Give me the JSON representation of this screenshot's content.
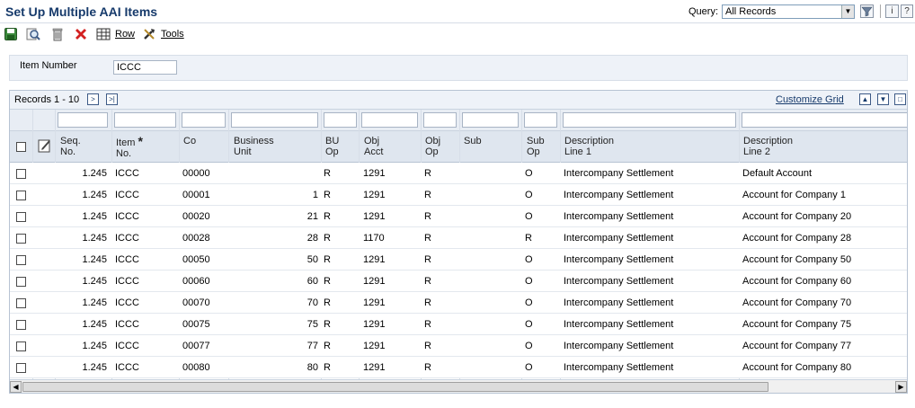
{
  "app": {
    "title": "Set Up Multiple AAI Items",
    "query_label": "Query:",
    "query_value": "All Records"
  },
  "toolbar": {
    "row_label": "Row",
    "tools_label": "Tools"
  },
  "header": {
    "item_number_label": "Item Number",
    "item_number_value": "ICCC"
  },
  "grid": {
    "records_label": "Records 1 - 10",
    "customize_label": "Customize Grid",
    "columns": [
      {
        "key": "seq",
        "line1": "Seq.",
        "line2": "No."
      },
      {
        "key": "item",
        "line1": "Item",
        "line2": "No."
      },
      {
        "key": "co",
        "line1": "",
        "line2": "Co"
      },
      {
        "key": "bu",
        "line1": "Business",
        "line2": "Unit"
      },
      {
        "key": "buop",
        "line1": "BU",
        "line2": "Op"
      },
      {
        "key": "obj",
        "line1": "Obj",
        "line2": "Acct"
      },
      {
        "key": "objop",
        "line1": "Obj",
        "line2": "Op"
      },
      {
        "key": "sub",
        "line1": "",
        "line2": "Sub"
      },
      {
        "key": "subop",
        "line1": "Sub",
        "line2": "Op"
      },
      {
        "key": "desc1",
        "line1": "Description",
        "line2": "Line 1"
      },
      {
        "key": "desc2",
        "line1": "Description",
        "line2": "Line 2"
      }
    ],
    "required_marker": "*",
    "rows": [
      {
        "seq": "1.245",
        "item": "ICCC",
        "co": "00000",
        "bu": "",
        "buop": "R",
        "obj": "1291",
        "objop": "R",
        "sub": "",
        "subop": "O",
        "desc1": "Intercompany Settlement",
        "desc2": "Default Account"
      },
      {
        "seq": "1.245",
        "item": "ICCC",
        "co": "00001",
        "bu": "1",
        "buop": "R",
        "obj": "1291",
        "objop": "R",
        "sub": "",
        "subop": "O",
        "desc1": "Intercompany Settlement",
        "desc2": "Account for Company 1"
      },
      {
        "seq": "1.245",
        "item": "ICCC",
        "co": "00020",
        "bu": "21",
        "buop": "R",
        "obj": "1291",
        "objop": "R",
        "sub": "",
        "subop": "O",
        "desc1": "Intercompany Settlement",
        "desc2": "Account for Company 20"
      },
      {
        "seq": "1.245",
        "item": "ICCC",
        "co": "00028",
        "bu": "28",
        "buop": "R",
        "obj": "1170",
        "objop": "R",
        "sub": "",
        "subop": "R",
        "desc1": "Intercompany Settlement",
        "desc2": "Account for Company 28"
      },
      {
        "seq": "1.245",
        "item": "ICCC",
        "co": "00050",
        "bu": "50",
        "buop": "R",
        "obj": "1291",
        "objop": "R",
        "sub": "",
        "subop": "O",
        "desc1": "Intercompany Settlement",
        "desc2": "Account for Company 50"
      },
      {
        "seq": "1.245",
        "item": "ICCC",
        "co": "00060",
        "bu": "60",
        "buop": "R",
        "obj": "1291",
        "objop": "R",
        "sub": "",
        "subop": "O",
        "desc1": "Intercompany Settlement",
        "desc2": "Account for Company 60"
      },
      {
        "seq": "1.245",
        "item": "ICCC",
        "co": "00070",
        "bu": "70",
        "buop": "R",
        "obj": "1291",
        "objop": "R",
        "sub": "",
        "subop": "O",
        "desc1": "Intercompany Settlement",
        "desc2": "Account for Company 70"
      },
      {
        "seq": "1.245",
        "item": "ICCC",
        "co": "00075",
        "bu": "75",
        "buop": "R",
        "obj": "1291",
        "objop": "R",
        "sub": "",
        "subop": "O",
        "desc1": "Intercompany Settlement",
        "desc2": "Account for Company 75"
      },
      {
        "seq": "1.245",
        "item": "ICCC",
        "co": "00077",
        "bu": "77",
        "buop": "R",
        "obj": "1291",
        "objop": "R",
        "sub": "",
        "subop": "O",
        "desc1": "Intercompany Settlement",
        "desc2": "Account for Company 77"
      },
      {
        "seq": "1.245",
        "item": "ICCC",
        "co": "00080",
        "bu": "80",
        "buop": "R",
        "obj": "1291",
        "objop": "R",
        "sub": "",
        "subop": "O",
        "desc1": "Intercompany Settlement",
        "desc2": "Account for Company 80"
      }
    ]
  },
  "icons": {
    "save": "save-icon",
    "query_find": "find-icon",
    "delete": "delete-icon",
    "cancel": "cancel-icon",
    "row": "row-menu-icon",
    "tools": "tools-icon",
    "filter": "filter-icon",
    "info": "info-icon",
    "help": "help-icon"
  }
}
